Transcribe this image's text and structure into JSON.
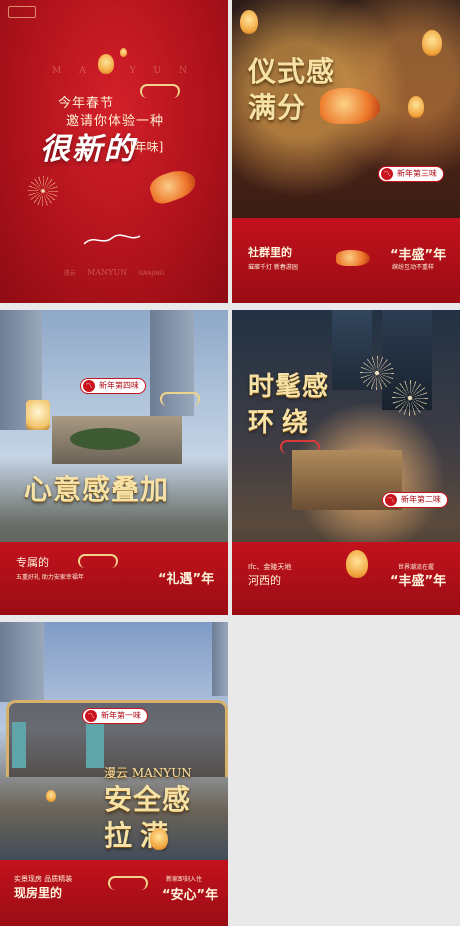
{
  "panel1": {
    "line1": "今年春节",
    "line2": "邀请你体验一种",
    "headline": "很新的",
    "tag": "[年味]",
    "manyun": "MANYUN",
    "foot_left": "漫云",
    "foot_center": "MANYUN",
    "foot_right": "NANJING"
  },
  "panel2": {
    "headline_1": "仪式感",
    "headline_2": "满分",
    "badge": "新年第三味",
    "left_title": "社群里的",
    "left_sub": "璀璨千灯 新春游园",
    "right_quote": "“丰盛”年",
    "right_sub": "缤纷互动不重样"
  },
  "panel3": {
    "badge": "新年第四味",
    "headline": "心意感叠加",
    "left_title": "专属的",
    "left_sub": "五重好礼 助力安家幸福年",
    "right_quote": "“礼遇”年"
  },
  "panel4": {
    "headline_1": "时髦感",
    "headline_2": "环绕",
    "badge": "新年第二味",
    "left_line1": "Ifc、金陵天地",
    "left_line2": "河西的",
    "right_sub": "世界潮流在握",
    "right_quote": "“丰盛”年"
  },
  "panel5": {
    "badge": "新年第一味",
    "brand_line": "漫云 MANYUN",
    "headline_1": "安全感",
    "headline_2": "拉满",
    "left_sub": "实景现房 品质精装",
    "left_title": "现房里的",
    "right_sub": "新家即刻入住",
    "right_quote": "“安心”年"
  },
  "colors": {
    "brand_red": "#b3101a",
    "gold": "#f6e2a6",
    "cream": "#fff4dc"
  }
}
